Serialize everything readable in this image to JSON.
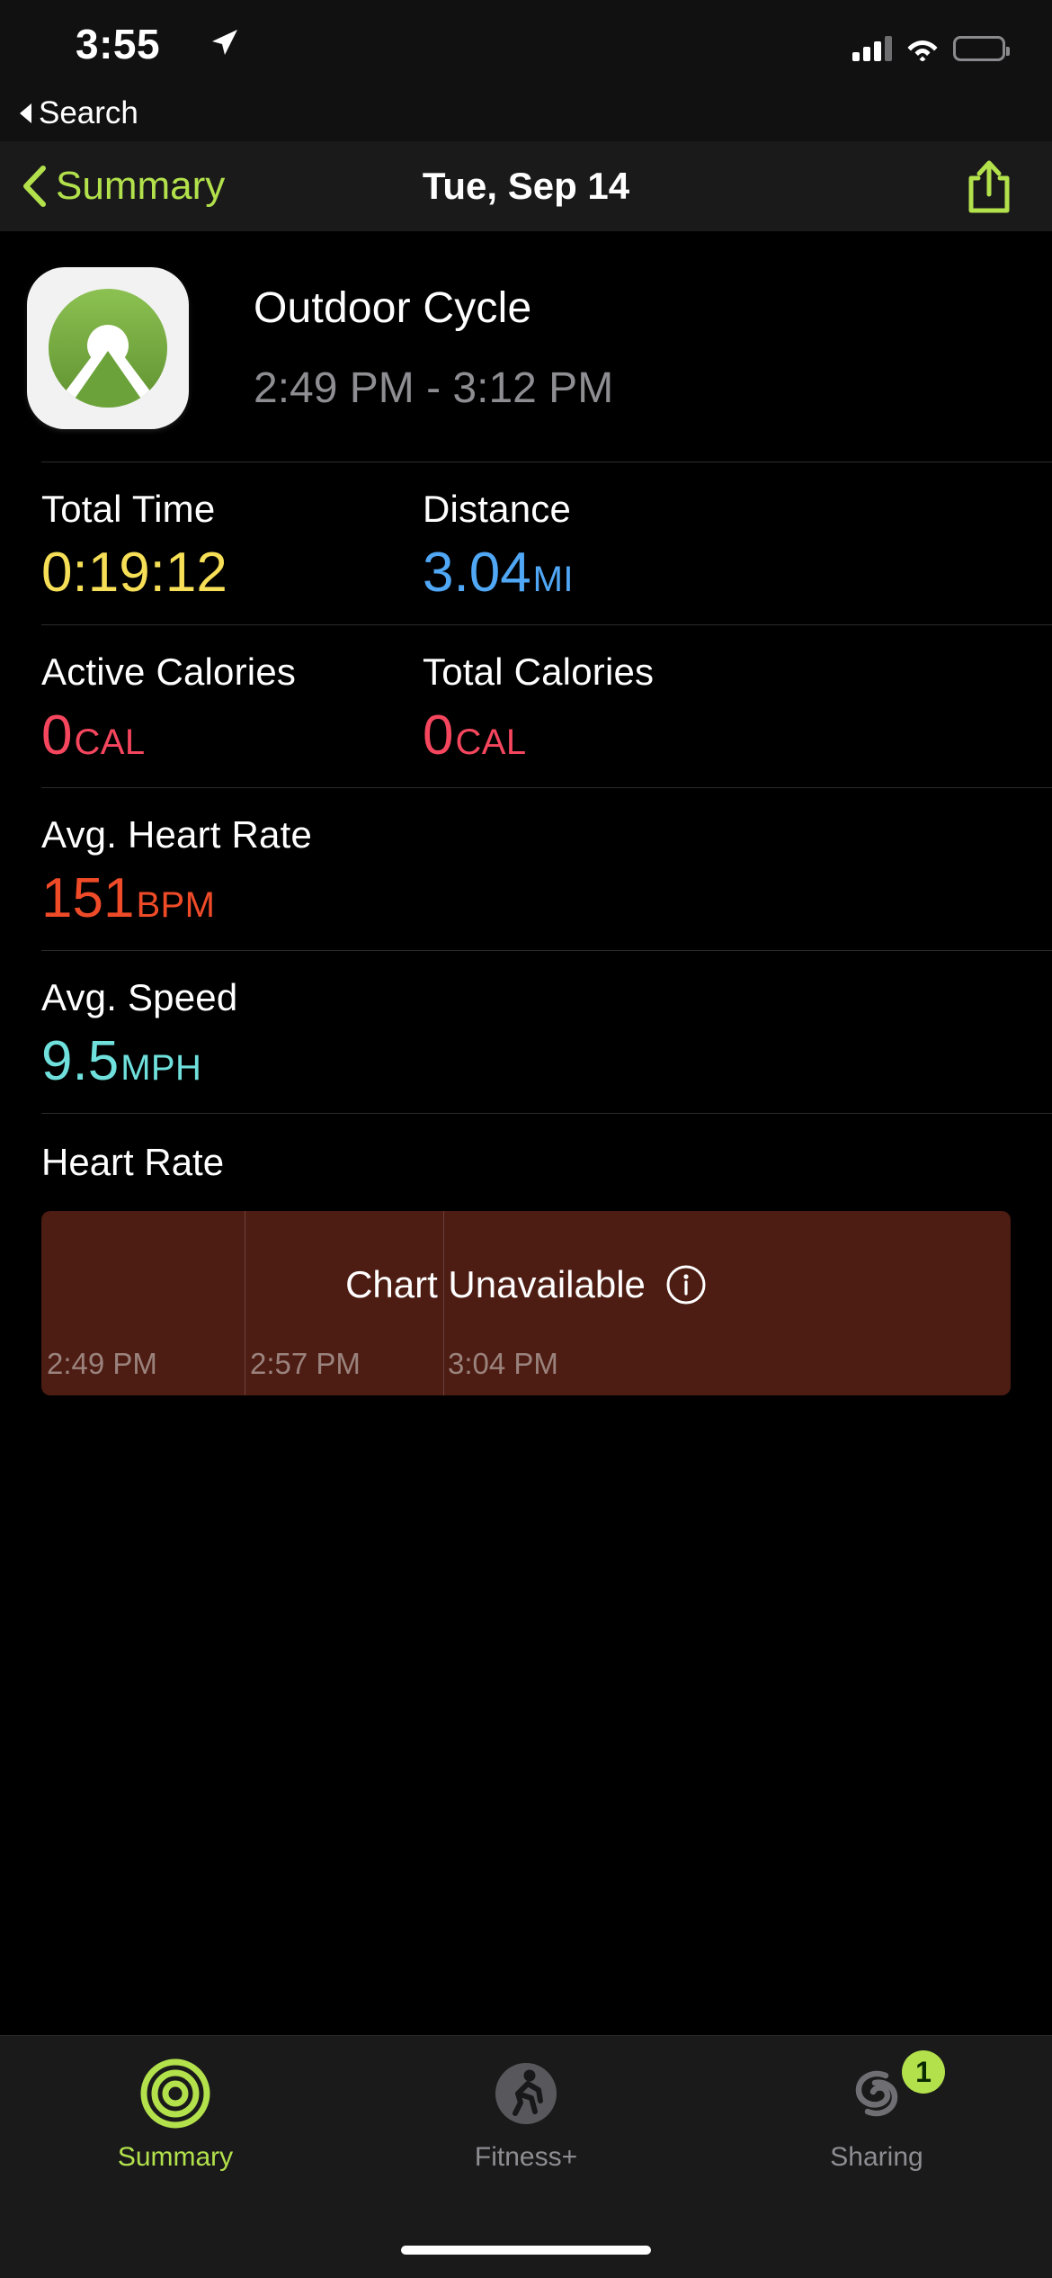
{
  "status_bar": {
    "time": "3:55",
    "location_icon": "location-arrow-icon",
    "cellular_icon": "cellular-signal-icon",
    "wifi_icon": "wifi-icon",
    "battery_icon": "battery-icon"
  },
  "breadcrumb": {
    "back_label": "Search",
    "icon": "back-triangle-icon"
  },
  "navbar": {
    "back_label": "Summary",
    "back_icon": "chevron-left-icon",
    "title": "Tue, Sep 14",
    "share_icon": "share-icon",
    "accent_color": "#b2e14b"
  },
  "workout": {
    "app_icon": "komoot-app-icon",
    "title": "Outdoor Cycle",
    "time_range": "2:49 PM - 3:12 PM"
  },
  "metrics": [
    {
      "label": "Total Time",
      "value": "0:19:12",
      "unit": "",
      "color": "#f6df57"
    },
    {
      "label": "Distance",
      "value": "3.04",
      "unit": "MI",
      "color": "#50a7f5"
    },
    {
      "label": "Active Calories",
      "value": "0",
      "unit": "CAL",
      "color": "#f5465e"
    },
    {
      "label": "Total Calories",
      "value": "0",
      "unit": "CAL",
      "color": "#f5465e"
    },
    {
      "label": "Avg. Heart Rate",
      "value": "151",
      "unit": "BPM",
      "color": "#ef4b28"
    },
    {
      "label": "Avg. Speed",
      "value": "9.5",
      "unit": "MPH",
      "color": "#6fe0dc"
    }
  ],
  "chart_data": {
    "type": "line",
    "title": "Heart Rate",
    "unavailable_message": "Chart Unavailable",
    "info_icon": "info-circle-icon",
    "xlabel": "",
    "ylabel": "",
    "x_ticks": [
      "2:49 PM",
      "2:57 PM",
      "3:04 PM"
    ],
    "series": [
      {
        "name": "Heart Rate",
        "values": []
      }
    ],
    "grid": true,
    "background_color": "#4d1c13",
    "legend": "none"
  },
  "tabbar": {
    "items": [
      {
        "label": "Summary",
        "icon": "activity-rings-icon",
        "active": true,
        "badge": ""
      },
      {
        "label": "Fitness+",
        "icon": "fitness-plus-icon",
        "active": false,
        "badge": ""
      },
      {
        "label": "Sharing",
        "icon": "sharing-icon",
        "active": false,
        "badge": "1"
      }
    ]
  }
}
